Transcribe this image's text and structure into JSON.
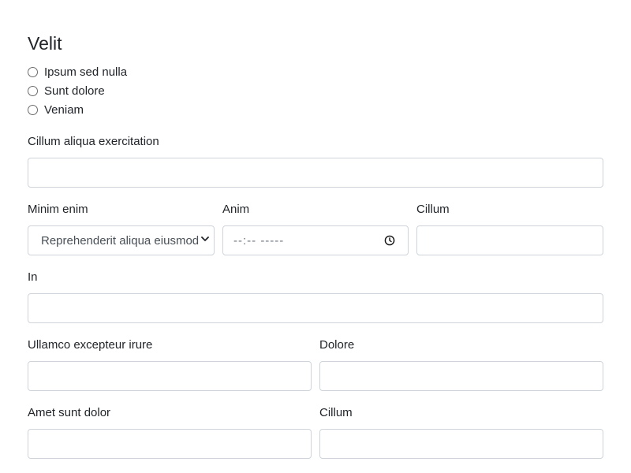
{
  "fieldset": {
    "legend": "Velit",
    "radios": [
      {
        "label": "Ipsum sed nulla",
        "checked": false
      },
      {
        "label": "Sunt dolore",
        "checked": false
      },
      {
        "label": "Veniam",
        "checked": false
      }
    ]
  },
  "fields": {
    "cillum_aliqua": {
      "label": "Cillum aliqua exercitation",
      "value": ""
    },
    "minim_enim": {
      "label": "Minim enim",
      "selected": "Reprehenderit aliqua eiusmod"
    },
    "anim": {
      "label": "Anim",
      "placeholder": "--:-- -----"
    },
    "cillum_1": {
      "label": "Cillum",
      "value": ""
    },
    "in": {
      "label": "In",
      "value": ""
    },
    "ullamco": {
      "label": "Ullamco excepteur irure",
      "value": ""
    },
    "dolore": {
      "label": "Dolore",
      "value": ""
    },
    "amet": {
      "label": "Amet sunt dolor",
      "value": ""
    },
    "cillum_2": {
      "label": "Cillum",
      "value": ""
    }
  }
}
